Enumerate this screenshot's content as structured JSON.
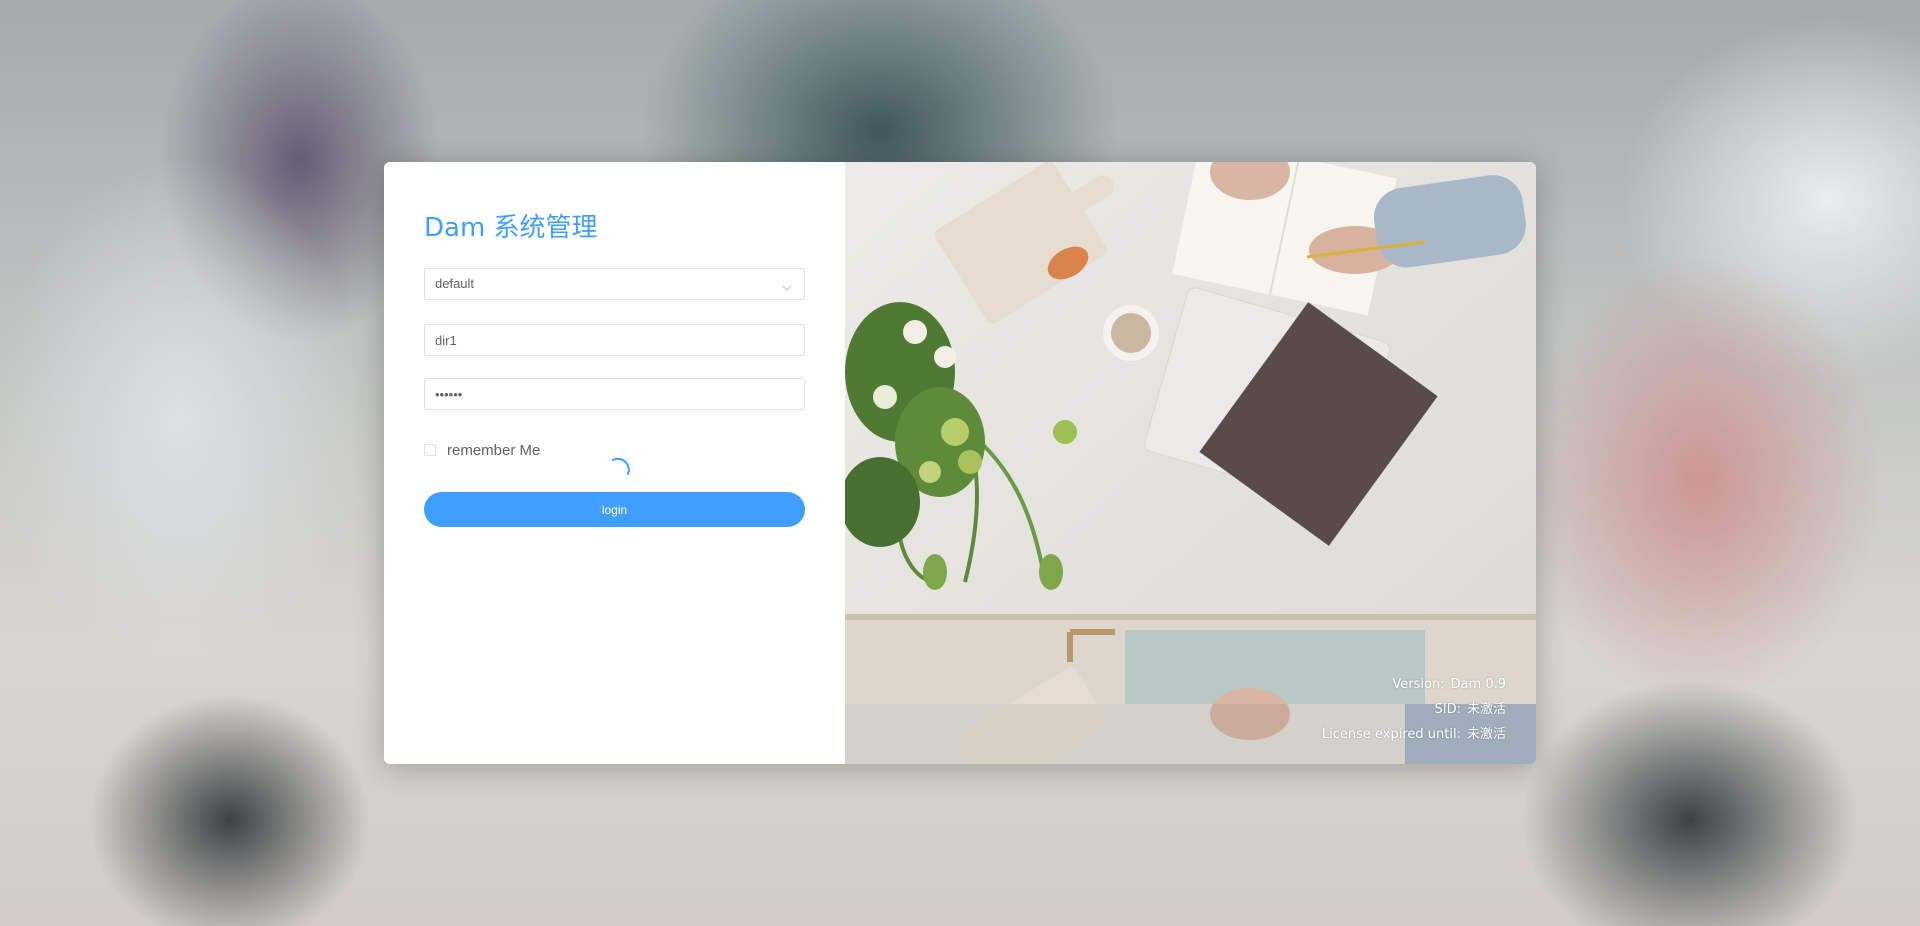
{
  "login": {
    "title": "Dam 系统管理",
    "domain_select": {
      "value": "default"
    },
    "username": {
      "value": "dir1"
    },
    "password": {
      "value": "dir1pw"
    },
    "remember_label": "remember Me",
    "remember_checked": false,
    "login_label": "login"
  },
  "info": {
    "version_label": "Version:",
    "version_value": "Dam 0.9",
    "sid_label": "SID:",
    "sid_value": "未激活",
    "license_label": "License expired until:",
    "license_value": "未激活"
  },
  "colors": {
    "accent": "#409eff",
    "border": "#dcdfe6",
    "text": "#606266"
  },
  "icons": {
    "select_arrow": "chevron-down-icon",
    "loading": "loading-spinner-icon"
  }
}
